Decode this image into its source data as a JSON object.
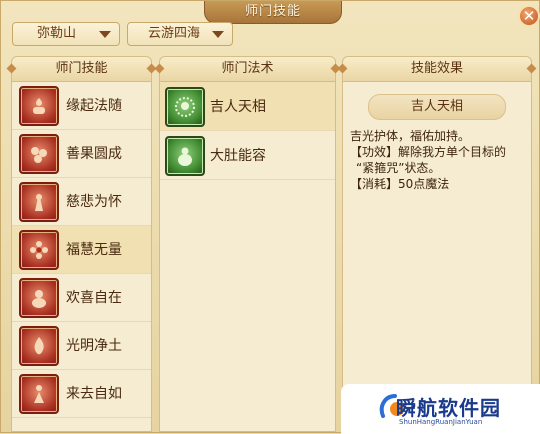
{
  "window": {
    "title": "师门技能",
    "close_glyph": "✕"
  },
  "filters": {
    "mountain": "弥勒山",
    "sect": "云游四海"
  },
  "panels": {
    "skills_header": "师门技能",
    "spells_header": "师门法术",
    "effect_header": "技能效果"
  },
  "skills": [
    {
      "label": "缘起法随",
      "icon": "lotus-pot-icon",
      "selected": false
    },
    {
      "label": "善果圆成",
      "icon": "fruit-icon",
      "selected": false
    },
    {
      "label": "慈悲为怀",
      "icon": "buddha-icon",
      "selected": false
    },
    {
      "label": "福慧无量",
      "icon": "flower-icon",
      "selected": true
    },
    {
      "label": "欢喜自在",
      "icon": "monk-icon",
      "selected": false
    },
    {
      "label": "光明净土",
      "icon": "flame-icon",
      "selected": false
    },
    {
      "label": "来去自如",
      "icon": "figure-icon",
      "selected": false
    }
  ],
  "spells": [
    {
      "label": "吉人天相",
      "icon": "halo-icon",
      "selected": true
    },
    {
      "label": "大肚能容",
      "icon": "belly-icon",
      "selected": false
    }
  ],
  "effect": {
    "name": "吉人天相",
    "lines": [
      "吉光护体，福佑加持。",
      "【功效】解除我方单个目标的",
      "“紧箍咒”状态。",
      "【消耗】50点魔法"
    ]
  },
  "watermark": {
    "title": "瞬航软件园",
    "subtitle": "ShunHangRuanJianYuan"
  },
  "colors": {
    "skill_icon": "#a92f22",
    "spell_icon": "#3f8a30",
    "selected_row": "#f1e0b2",
    "title_tab": "#b7864a"
  }
}
